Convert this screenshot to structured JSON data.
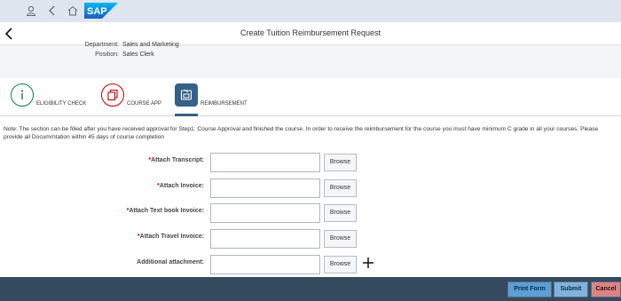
{
  "shell": {
    "logo_text": "SAP",
    "icons": [
      "user-icon",
      "back-arrow-icon",
      "home-icon"
    ]
  },
  "header": {
    "title": "Create Tuition Reimbursement Request"
  },
  "employee_info": {
    "department_label": "Department:",
    "department_value": "Sales and Marketing",
    "position_label": "Position:",
    "position_value": "Sales Clerk"
  },
  "tabs": [
    {
      "label": "ELIGIBILITY CHECK",
      "icon": "info-icon",
      "color": "#107e3e"
    },
    {
      "label": "COURSE APP",
      "icon": "copy-icon",
      "color": "#bb0000"
    },
    {
      "label": "REIMBURSEMENT",
      "icon": "payment-icon",
      "color": "#346187"
    }
  ],
  "note": "Note: The section can be filled after you have received approval for Step1: Course Approval and finished the course. In order to receive the reimbursement for the course you must have minimum C grade in all your courses. Please provide all Documrntation within 45 days of course completion",
  "form": {
    "fields": [
      {
        "label": "Attach Transcript:",
        "required": true,
        "value": "",
        "browse_label": "Browse"
      },
      {
        "label": "Attach Invoice:",
        "required": true,
        "value": "",
        "browse_label": "Browse"
      },
      {
        "label": "Attach Text book Invoice:",
        "required": true,
        "value": "",
        "browse_label": "Browse"
      },
      {
        "label": "Attach Travel Invoice:",
        "required": true,
        "value": "",
        "browse_label": "Browse"
      },
      {
        "label": "Additional attachment:",
        "required": false,
        "value": "",
        "browse_label": "Browse"
      }
    ],
    "required_marker": "*"
  },
  "footer": {
    "print_label": "Print Form",
    "submit_label": "Submit",
    "cancel_label": "Cancel"
  },
  "colors": {
    "shell_bg": "#dfe5ee",
    "footer_bg": "#354a5f",
    "accent": "#346187",
    "required": "#bb0000"
  }
}
